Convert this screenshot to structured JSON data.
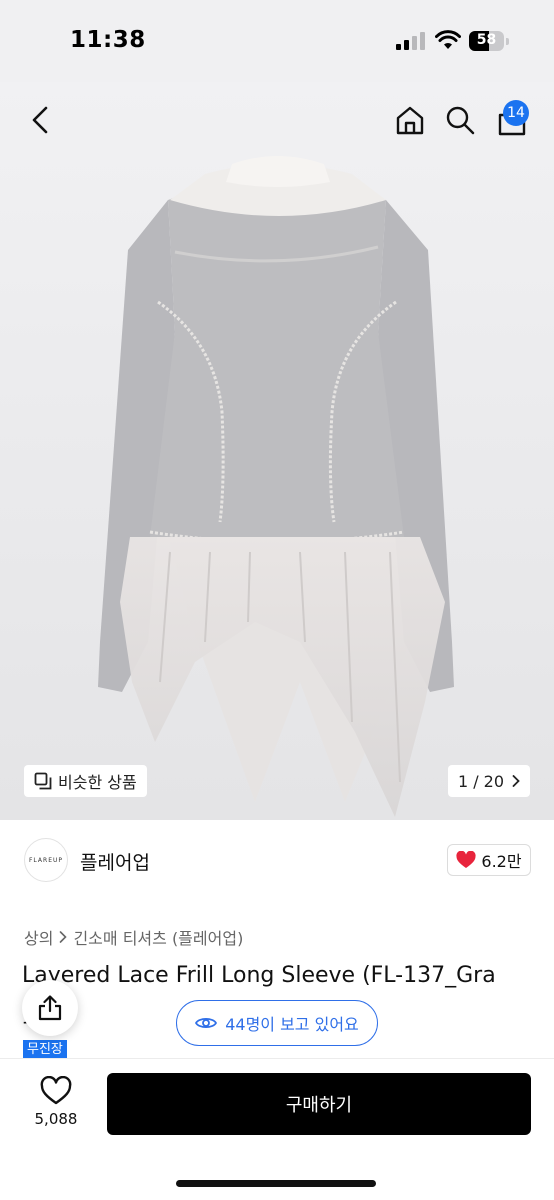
{
  "status_bar": {
    "time": "11:38",
    "battery": "58",
    "battery_level": 0.58
  },
  "header": {
    "cart_count": "14"
  },
  "image": {
    "similar_label": "비슷한 상품",
    "page_counter": "1 / 20"
  },
  "brand": {
    "logo_text": "FLAREUP",
    "name": "플레어업",
    "likes": "6.2만"
  },
  "breadcrumb": {
    "category": "상의",
    "subcategory": "긴소매 티셔츠 (플레어업)"
  },
  "product": {
    "title": "Layered Lace Frill Long Sleeve (FL-137_Gra",
    "title_line2": "y",
    "tag": "무진장"
  },
  "viewers": {
    "text": "44명이 보고 있어요"
  },
  "bottom": {
    "wish_count": "5,088",
    "buy_label": "구매하기"
  },
  "colors": {
    "accent": "#1b73f0",
    "like_heart": "#e8243c",
    "buy_button": "#000000"
  },
  "icons": [
    "back-icon",
    "home-icon",
    "search-icon",
    "cart-icon",
    "similar-icon",
    "chevron-right-icon",
    "heart-icon",
    "share-icon",
    "eye-icon"
  ]
}
